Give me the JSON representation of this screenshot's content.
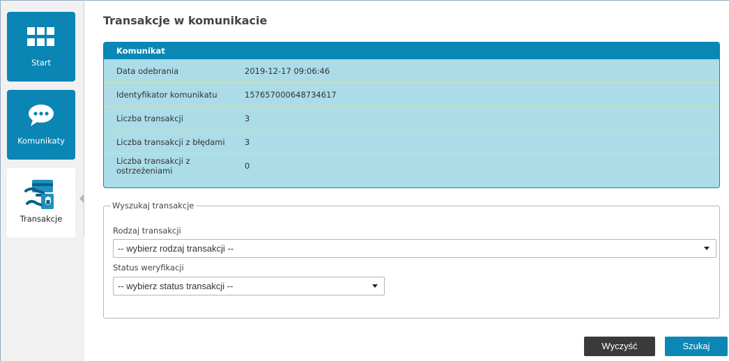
{
  "sidebar": {
    "items": [
      {
        "label": "Start",
        "icon": "grid-icon",
        "state": "default"
      },
      {
        "label": "Komunikaty",
        "icon": "chat-bubble-icon",
        "state": "default"
      },
      {
        "label": "Transakcje",
        "icon": "hand-card-transaction-icon",
        "state": "selected"
      }
    ]
  },
  "main": {
    "title": "Transakcje w komunikacie",
    "message_panel": {
      "header": "Komunikat",
      "rows": [
        {
          "label": "Data odebrania",
          "value": "2019-12-17 09:06:46"
        },
        {
          "label": "Identyfikator komunikatu",
          "value": "157657000648734617"
        },
        {
          "label": "Liczba transakcji",
          "value": "3"
        },
        {
          "label": "Liczba transakcji z błędami",
          "value": "3"
        },
        {
          "label": "Liczba transakcji z ostrzeżeniami",
          "value": "0"
        }
      ]
    },
    "search": {
      "legend": "Wyszukaj transakcje",
      "transaction_type": {
        "label": "Rodzaj transakcji",
        "selected": "-- wybierz rodzaj transakcji --"
      },
      "verification_status": {
        "label": "Status weryfikacji",
        "selected": "-- wybierz status transakcji --"
      }
    },
    "buttons": {
      "clear": "Wyczyść",
      "search": "Szukaj"
    }
  },
  "colors": {
    "accent": "#0a87b5",
    "panel_bg": "#abdce8",
    "row_divider": "#cfe6a8",
    "clear_button": "#3a3a3a"
  }
}
